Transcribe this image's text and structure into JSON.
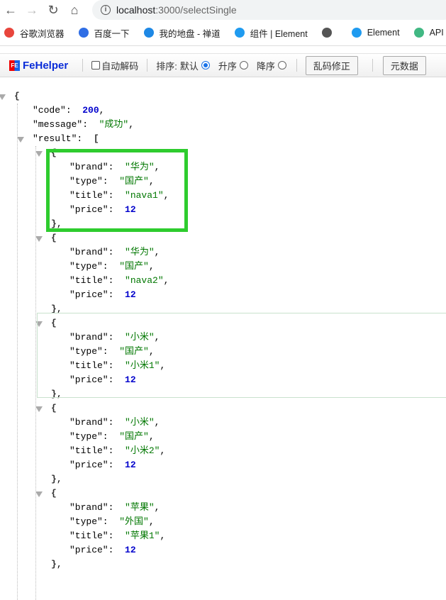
{
  "browser": {
    "url_host": "localhost",
    "url_path": ":3000/selectSingle",
    "bookmarks": [
      {
        "label": "谷歌浏览器",
        "icon": "chrome-icon",
        "color": "#e8453c"
      },
      {
        "label": "百度一下",
        "icon": "baidu-paw-icon",
        "color": "#2f6ee5"
      },
      {
        "label": "我的地盘 - 禅道",
        "icon": "zentao-icon",
        "color": "#1e88e5"
      },
      {
        "label": "组件 | Element",
        "icon": "element-icon",
        "color": "#1f9bf0"
      },
      {
        "label": "",
        "icon": "globe-icon",
        "color": "#555555"
      },
      {
        "label": "Element",
        "icon": "element-icon",
        "color": "#1f9bf0"
      },
      {
        "label": "API — V",
        "icon": "vue-icon",
        "color": "#41b883"
      }
    ]
  },
  "fehelper": {
    "logo": "FeHelper",
    "auto_decode": "自动解码",
    "sort_label": "排序:",
    "sort_default": "默认",
    "sort_asc": "升序",
    "sort_desc": "降序",
    "fix_button": "乱码修正",
    "meta_button": "元数据"
  },
  "json": {
    "code_key": "\"code\"",
    "code": "200",
    "message_key": "\"message\"",
    "message": "\"成功\"",
    "result_key": "\"result\"",
    "items": [
      {
        "brand": "华为",
        "type": "国产",
        "title": "nava1",
        "price": "12"
      },
      {
        "brand": "华为",
        "type": "国产",
        "title": "nava2",
        "price": "12"
      },
      {
        "brand": "小米",
        "type": "国产",
        "title": "小米1",
        "price": "12"
      },
      {
        "brand": "小米",
        "type": "国产",
        "title": "小米2",
        "price": "12"
      },
      {
        "brand": "苹果",
        "type": "外国",
        "title": "苹果1",
        "price": "12"
      }
    ]
  },
  "highlight_color": "#2ecc2e"
}
